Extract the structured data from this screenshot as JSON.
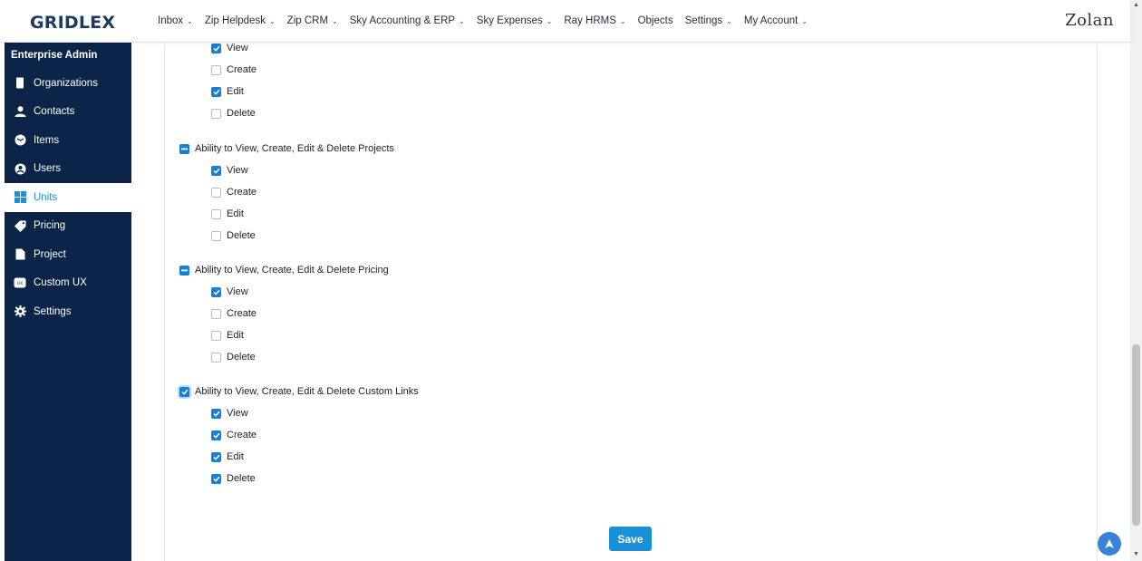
{
  "header": {
    "logo": "GRIDLEX",
    "brand": "Zolan",
    "nav": [
      {
        "label": "Inbox",
        "has_dropdown": true
      },
      {
        "label": "Zip Helpdesk",
        "has_dropdown": true
      },
      {
        "label": "Zip CRM",
        "has_dropdown": true
      },
      {
        "label": "Sky Accounting & ERP",
        "has_dropdown": true
      },
      {
        "label": "Sky Expenses",
        "has_dropdown": true
      },
      {
        "label": "Ray HRMS",
        "has_dropdown": true
      },
      {
        "label": "Objects",
        "has_dropdown": false
      },
      {
        "label": "Settings",
        "has_dropdown": true
      },
      {
        "label": "My Account",
        "has_dropdown": true
      }
    ]
  },
  "sidebar": {
    "title": "Enterprise Admin",
    "items": [
      {
        "label": "Organizations",
        "icon": "building-icon",
        "active": false
      },
      {
        "label": "Contacts",
        "icon": "user-icon",
        "active": false
      },
      {
        "label": "Items",
        "icon": "cube-icon",
        "active": false
      },
      {
        "label": "Users",
        "icon": "user-circle-icon",
        "active": false
      },
      {
        "label": "Units",
        "icon": "grid-icon",
        "active": true
      },
      {
        "label": "Pricing",
        "icon": "tag-icon",
        "active": false
      },
      {
        "label": "Project",
        "icon": "file-icon",
        "active": false
      },
      {
        "label": "Custom UX",
        "icon": "ux-icon",
        "active": false
      },
      {
        "label": "Settings",
        "icon": "gear-icon",
        "active": false
      }
    ]
  },
  "permissions": {
    "top_items": [
      {
        "label": "View",
        "checked": true
      },
      {
        "label": "Create",
        "checked": false
      },
      {
        "label": "Edit",
        "checked": true
      },
      {
        "label": "Delete",
        "checked": false
      }
    ],
    "groups": [
      {
        "label": "Ability to View, Create, Edit & Delete Projects",
        "state": "partial",
        "items": [
          {
            "label": "View",
            "checked": true
          },
          {
            "label": "Create",
            "checked": false
          },
          {
            "label": "Edit",
            "checked": false
          },
          {
            "label": "Delete",
            "checked": false
          }
        ]
      },
      {
        "label": "Ability to View, Create, Edit & Delete Pricing",
        "state": "partial",
        "items": [
          {
            "label": "View",
            "checked": true
          },
          {
            "label": "Create",
            "checked": false
          },
          {
            "label": "Edit",
            "checked": false
          },
          {
            "label": "Delete",
            "checked": false
          }
        ]
      },
      {
        "label": "Ability to View, Create, Edit & Delete Custom Links",
        "state": "checked",
        "items": [
          {
            "label": "View",
            "checked": true
          },
          {
            "label": "Create",
            "checked": true
          },
          {
            "label": "Edit",
            "checked": true
          },
          {
            "label": "Delete",
            "checked": true
          }
        ]
      }
    ]
  },
  "save_label": "Save",
  "colors": {
    "accent": "#1a7fd4",
    "sidebar_bg": "#0b2447",
    "active_text": "#1e90d6",
    "button": "#1a90d9"
  }
}
